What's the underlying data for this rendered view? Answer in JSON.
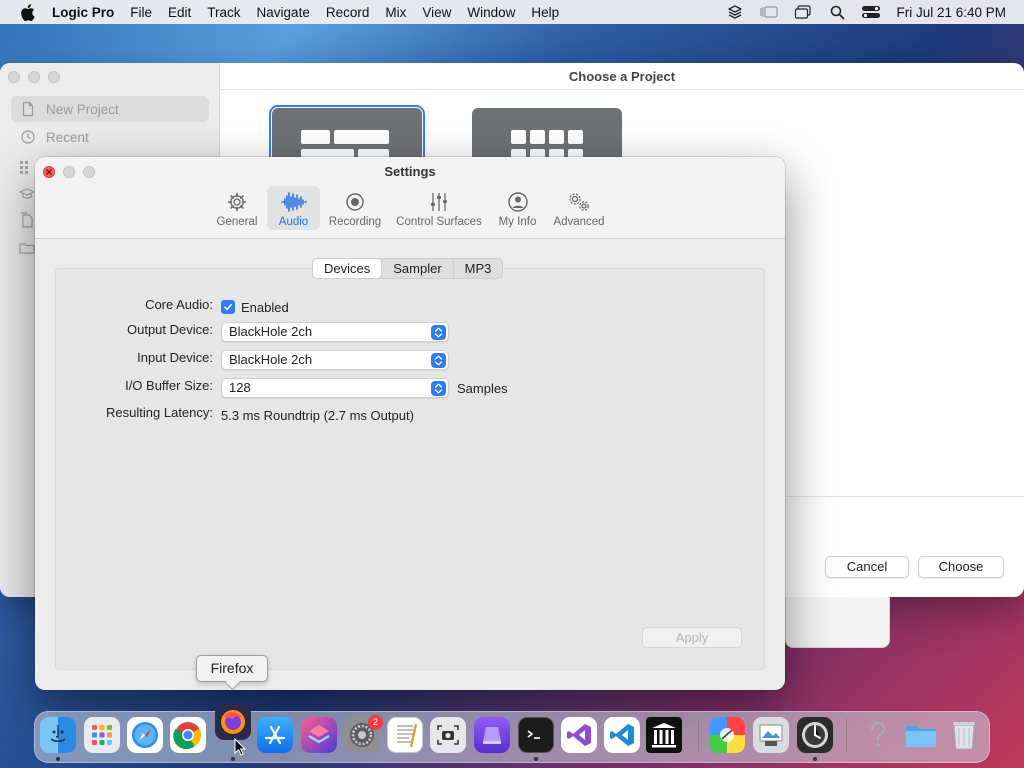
{
  "menubar": {
    "apple_icon": "apple-logo-icon",
    "app_name": "Logic Pro",
    "items": [
      "File",
      "Edit",
      "Track",
      "Navigate",
      "Record",
      "Mix",
      "View",
      "Window",
      "Help"
    ],
    "status_icons": [
      "layers-icon",
      "stage-manager-icon",
      "window-icon",
      "search-icon",
      "control-center-icon"
    ],
    "clock": "Fri Jul 21  6:40 PM"
  },
  "project_window": {
    "title": "Choose a Project",
    "sidebar": [
      {
        "label": "New Project",
        "icon": "document-icon",
        "selected": true
      },
      {
        "label": "Recent",
        "icon": "clock-icon",
        "selected": false
      }
    ],
    "sidebar_extra_icons": [
      "grid-icon",
      "graduation-cap-icon",
      "documents-icon",
      "folder-icon"
    ],
    "buttons": {
      "cancel": "Cancel",
      "choose": "Choose"
    }
  },
  "settings": {
    "title": "Settings",
    "tabs": [
      {
        "label": "General",
        "icon": "gear-icon"
      },
      {
        "label": "Audio",
        "icon": "waveform-icon",
        "selected": true
      },
      {
        "label": "Recording",
        "icon": "record-icon"
      },
      {
        "label": "Control Surfaces",
        "icon": "sliders-icon"
      },
      {
        "label": "My Info",
        "icon": "person-icon"
      },
      {
        "label": "Advanced",
        "icon": "gears-icon"
      }
    ],
    "subtabs": [
      {
        "label": "Devices",
        "selected": true
      },
      {
        "label": "Sampler"
      },
      {
        "label": "MP3"
      }
    ],
    "devices": {
      "core_audio_label": "Core Audio:",
      "core_audio_value": "Enabled",
      "core_audio_checked": true,
      "output_label": "Output Device:",
      "output_value": "BlackHole 2ch",
      "input_label": "Input Device:",
      "input_value": "BlackHole 2ch",
      "buffer_label": "I/O Buffer Size:",
      "buffer_value": "128",
      "buffer_unit": "Samples",
      "latency_label": "Resulting Latency:",
      "latency_value": "5.3 ms Roundtrip (2.7 ms Output)"
    },
    "apply_label": "Apply"
  },
  "tooltip": "Firefox",
  "dock": {
    "apps": [
      "Finder",
      "Launchpad",
      "Safari",
      "Chrome",
      "Firefox",
      "App Store",
      "Shortcuts",
      "System Settings",
      "TextEdit",
      "Screenshot",
      "Simulator",
      "Terminal",
      "Visual Studio",
      "VS Code",
      "Library",
      "ColorSync",
      "Preview",
      "Logic Pro",
      "Help",
      "Downloads",
      "Trash"
    ],
    "system_settings_badge": "2",
    "accent": "#2f7cf6"
  }
}
